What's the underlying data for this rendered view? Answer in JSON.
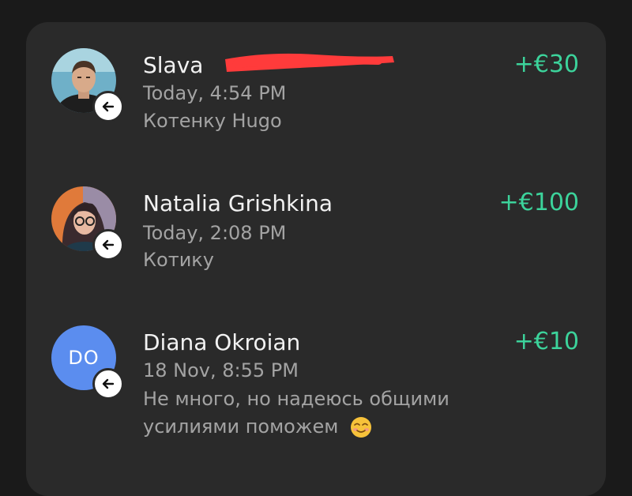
{
  "transactions": [
    {
      "name": "Slava",
      "amount": "+€30",
      "time": "Today, 4:54 PM",
      "note": "Котенку Hugo",
      "avatar": "photo-man-icon",
      "direction_icon": "arrow-left-icon",
      "name_redacted": true
    },
    {
      "name": "Natalia Grishkina",
      "amount": "+€100",
      "time": "Today, 2:08 PM",
      "note": "Котику",
      "avatar": "photo-woman-icon",
      "direction_icon": "arrow-left-icon"
    },
    {
      "name": "Diana Okroian",
      "amount": "+€10",
      "initials": "DO",
      "time": "18 Nov, 8:55 PM",
      "note_line1": "Не много, но надеюсь общими",
      "note_line2": "усилиями поможем",
      "note_emoji": "smiling-face-emoji",
      "direction_icon": "arrow-left-icon"
    }
  ],
  "colors": {
    "background": "#1a1a1a",
    "card": "#2a2a2a",
    "amount_positive": "#3cd39b",
    "secondary_text": "#a3a3a3",
    "initials_avatar": "#5b8def",
    "redaction": "#ff3b3b"
  }
}
